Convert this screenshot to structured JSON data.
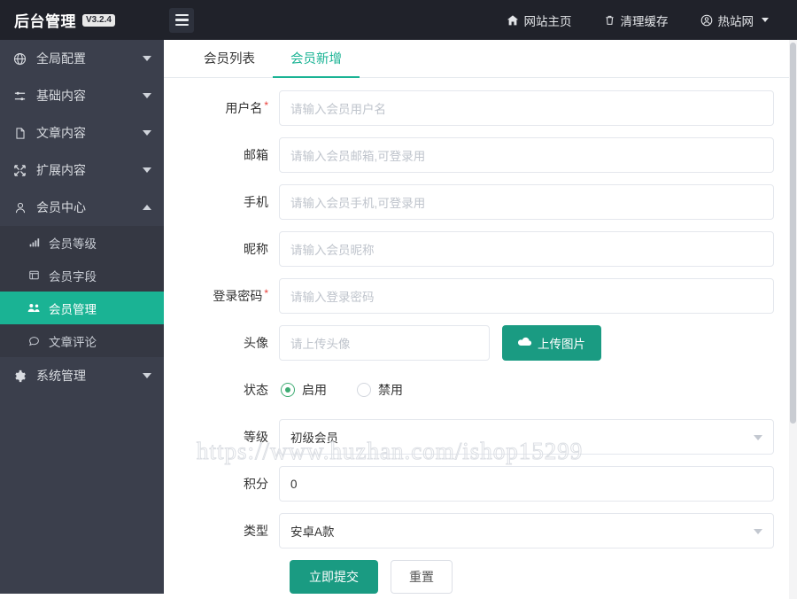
{
  "header": {
    "logo_text": "后台管理",
    "version": "V3.2.4",
    "menu_toggle_icon": "hamburger-icon",
    "nav": [
      {
        "label": "网站主页",
        "icon": "home-icon"
      },
      {
        "label": "清理缓存",
        "icon": "trash-icon"
      },
      {
        "label": "热站网",
        "icon": "user-circle-icon",
        "has_caret": true
      }
    ]
  },
  "sidebar": {
    "groups": [
      {
        "label": "全局配置",
        "icon": "globe-icon",
        "expanded": false
      },
      {
        "label": "基础内容",
        "icon": "sliders-icon",
        "expanded": false
      },
      {
        "label": "文章内容",
        "icon": "file-icon",
        "expanded": false
      },
      {
        "label": "扩展内容",
        "icon": "expand-icon",
        "expanded": false
      },
      {
        "label": "会员中心",
        "icon": "user-icon",
        "expanded": true
      },
      {
        "label": "系统管理",
        "icon": "gear-icon",
        "expanded": false
      }
    ],
    "member_center_items": [
      {
        "label": "会员等级",
        "icon": "bar-chart-icon",
        "active": false
      },
      {
        "label": "会员字段",
        "icon": "form-icon",
        "active": false
      },
      {
        "label": "会员管理",
        "icon": "users-icon",
        "active": true
      },
      {
        "label": "文章评论",
        "icon": "comment-icon",
        "active": false
      }
    ]
  },
  "main": {
    "tabs": [
      {
        "label": "会员列表",
        "active": false
      },
      {
        "label": "会员新增",
        "active": true
      }
    ],
    "form": {
      "username": {
        "label": "用户名",
        "required": true,
        "placeholder": "请输入会员用户名",
        "value": ""
      },
      "email": {
        "label": "邮箱",
        "required": false,
        "placeholder": "请输入会员邮箱,可登录用",
        "value": ""
      },
      "mobile": {
        "label": "手机",
        "required": false,
        "placeholder": "请输入会员手机,可登录用",
        "value": ""
      },
      "nickname": {
        "label": "昵称",
        "required": false,
        "placeholder": "请输入会员昵称",
        "value": ""
      },
      "password": {
        "label": "登录密码",
        "required": true,
        "placeholder": "请输入登录密码",
        "value": ""
      },
      "avatar": {
        "label": "头像",
        "placeholder": "请上传头像",
        "value": "",
        "upload_button": "上传图片",
        "upload_icon": "cloud-upload-icon"
      },
      "status": {
        "label": "状态",
        "options": [
          {
            "label": "启用",
            "checked": true
          },
          {
            "label": "禁用",
            "checked": false
          }
        ]
      },
      "level": {
        "label": "等级",
        "value": "初级会员"
      },
      "points": {
        "label": "积分",
        "value": "0"
      },
      "type": {
        "label": "类型",
        "value": "安卓A款"
      },
      "submit_button": "立即提交",
      "reset_button": "重置"
    }
  },
  "watermark": "https://www.huzhan.com/ishop15299",
  "colors": {
    "accent_green": "#1ab394",
    "button_green": "#1a9b82",
    "sidebar_bg": "#3b3f4c",
    "topbar_bg": "#20222a",
    "required_red": "#e8403a"
  }
}
